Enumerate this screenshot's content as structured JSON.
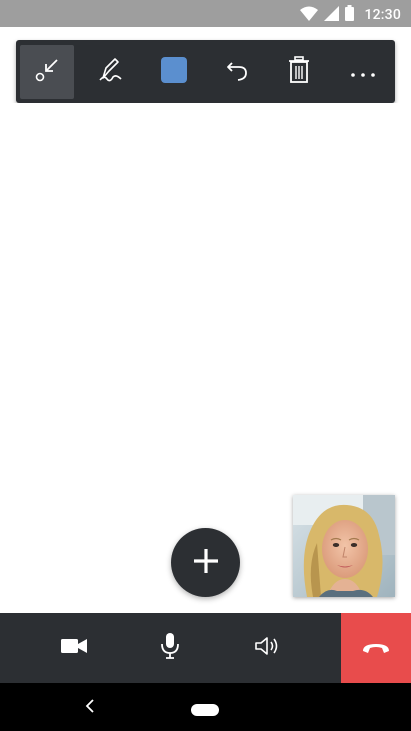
{
  "status_bar": {
    "time": "12:30",
    "icons": [
      "wifi-icon",
      "signal-icon",
      "battery-icon"
    ]
  },
  "toolbar": {
    "tools": [
      {
        "name": "collapse-toolbar",
        "icon": "arrow-collapse-icon",
        "active": true
      },
      {
        "name": "pen",
        "icon": "pen-icon",
        "active": false
      },
      {
        "name": "color",
        "icon": "color-swatch-icon",
        "active": false,
        "color": "#5b8fcf"
      },
      {
        "name": "undo",
        "icon": "undo-icon",
        "active": false
      },
      {
        "name": "delete",
        "icon": "trash-icon",
        "active": false
      },
      {
        "name": "more",
        "icon": "more-horizontal-icon",
        "active": false
      }
    ]
  },
  "fab": {
    "icon": "plus-icon"
  },
  "self_view": {
    "description_icon": "participant-avatar"
  },
  "call_bar": {
    "buttons": [
      {
        "name": "camera",
        "icon": "video-camera-icon"
      },
      {
        "name": "microphone",
        "icon": "microphone-icon"
      },
      {
        "name": "speaker",
        "icon": "speaker-icon"
      },
      {
        "name": "end-call",
        "icon": "phone-hangup-icon",
        "color": "#e84c4c"
      }
    ]
  },
  "nav_bar": {
    "icons": [
      "back-icon",
      "home-pill-icon"
    ]
  },
  "colors": {
    "status_bar": "#9e9e9e",
    "toolbar": "#2c2f33",
    "toolbar_active": "#4a4d52",
    "end_call": "#e84c4c",
    "swatch": "#5b8fcf"
  }
}
